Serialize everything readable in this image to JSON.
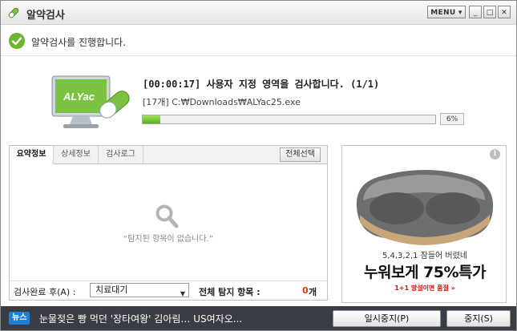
{
  "window": {
    "title": "알약검사",
    "menu_label": "MENU ▾",
    "minimize_label": "_",
    "maximize_label": "□",
    "close_label": "✕"
  },
  "status": {
    "text": "알약검사를 진행합니다."
  },
  "scan": {
    "main_text": "[00:00:17] 사용자 지정 영역을 검사합니다. (1/1)",
    "file_text": "[17개] C:₩Downloads₩ALYac25.exe",
    "progress_percent": 6,
    "progress_label": "6%",
    "logo_text": "ALYac"
  },
  "tabs": [
    {
      "label": "요약정보",
      "active": true
    },
    {
      "label": "상세정보",
      "active": false
    },
    {
      "label": "검사로그",
      "active": false
    }
  ],
  "results": {
    "select_all_label": "전체선택",
    "empty_text": "“탐지된 항목이 없습니다.”",
    "after_scan_label": "검사완료 후(A) :",
    "after_scan_value": "치료대기",
    "total_label": "전체 탐지 항목 :",
    "total_count": "0",
    "total_unit": "개"
  },
  "ad": {
    "sub_text": "5,4,3,2,1 잠들어 버렸네",
    "headline": "누워보게 75%특가",
    "promo": "1+1 망설이면 품절 »"
  },
  "news": {
    "badge": "뉴스",
    "text": "눈물젖은 빵 먹던 '장타여왕' 김아림… US여자오..."
  },
  "buttons": {
    "pause_label": "일시중지(P)",
    "stop_label": "중지(S)"
  },
  "colors": {
    "accent_green": "#5cae23",
    "count_red": "#e03a00",
    "news_bg": "#3a3d44",
    "news_badge": "#1e7fd6"
  }
}
